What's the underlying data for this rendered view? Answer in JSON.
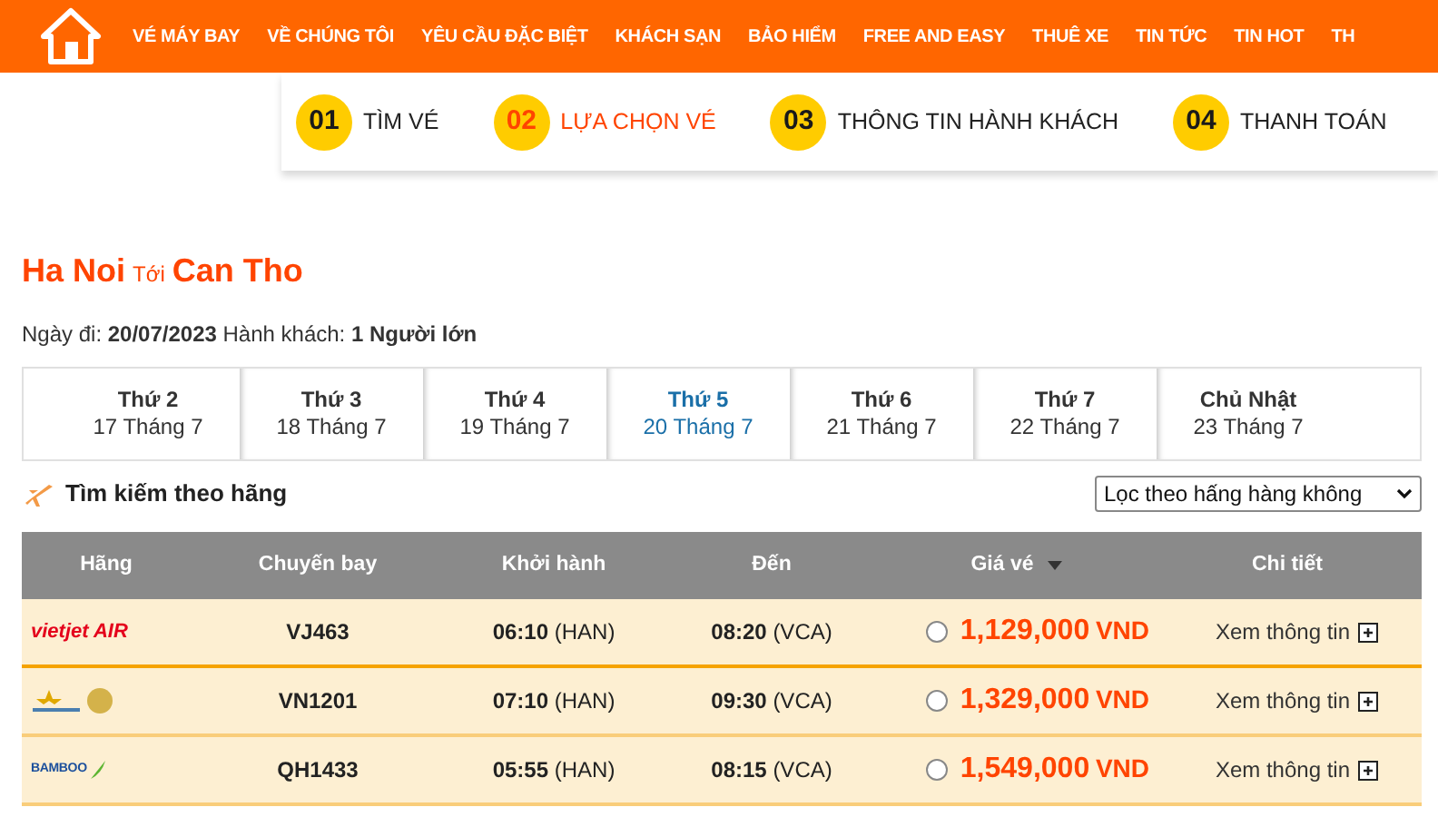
{
  "nav": {
    "items": [
      "VÉ MÁY BAY",
      "VỀ CHÚNG TÔI",
      "YÊU CẦU ĐẶC BIỆT",
      "KHÁCH SẠN",
      "BẢO HIỂM",
      "FREE AND EASY",
      "THUÊ XE",
      "TIN TỨC",
      "TIN HOT",
      "TH"
    ]
  },
  "steps": [
    {
      "number": "01",
      "label": "TÌM VÉ",
      "selected": false
    },
    {
      "number": "02",
      "label": "LỰA CHỌN VÉ",
      "selected": true
    },
    {
      "number": "03",
      "label": "THÔNG TIN HÀNH KHÁCH",
      "selected": false
    },
    {
      "number": "04",
      "label": "THANH TOÁN",
      "selected": false
    }
  ],
  "route": {
    "from": "Ha Noi",
    "connector": "Tới",
    "to": "Can Tho"
  },
  "summary": "Ngày đi: **20/07/2023** Hành khách: **1 Người lớn**",
  "days": [
    {
      "weekday": "Thứ 2",
      "date": "17 Tháng 7",
      "selected": false
    },
    {
      "weekday": "Thứ 3",
      "date": "18 Tháng 7",
      "selected": false
    },
    {
      "weekday": "Thứ 4",
      "date": "19 Tháng 7",
      "selected": false
    },
    {
      "weekday": "Thứ 5",
      "date": "20 Tháng 7",
      "selected": true
    },
    {
      "weekday": "Thứ 6",
      "date": "21 Tháng 7",
      "selected": false
    },
    {
      "weekday": "Thứ 7",
      "date": "22 Tháng 7",
      "selected": false
    },
    {
      "weekday": "Chủ Nhật",
      "date": "23 Tháng 7",
      "selected": false
    }
  ],
  "airline_search": {
    "title": "Tìm kiếm theo hãng",
    "filter": "Lọc theo hấng hàng không"
  },
  "table": {
    "columns": [
      "Hãng",
      "Chuyến bay",
      "Khởi hành",
      "Đến",
      "Giá vé",
      "Chi tiết"
    ],
    "rows": [
      {
        "logo": {
          "kind": "vietjet",
          "text": "vietjet AIR"
        },
        "flight": "VJ463",
        "depart": "06:10",
        "depart_code": "(HAN)",
        "arrive": "08:20",
        "arrive_code": "(VCA)",
        "selected": false,
        "price": "1,129,000",
        "currency": "VND",
        "details": "Xem thông tin"
      },
      {
        "logo": {
          "kind": "vietnam"
        },
        "flight": "VN1201",
        "depart": "07:10",
        "depart_code": "(HAN)",
        "arrive": "09:30",
        "arrive_code": "(VCA)",
        "selected": false,
        "price": "1,329,000",
        "currency": "VND",
        "details": "Xem thông tin"
      },
      {
        "logo": {
          "kind": "bamboo",
          "text": "BAMBOO"
        },
        "flight": "QH1433",
        "depart": "05:55",
        "depart_code": "(HAN)",
        "arrive": "08:15",
        "arrive_code": "(VCA)",
        "selected": false,
        "price": "1,549,000",
        "currency": "VND",
        "details": "Xem thông tin"
      }
    ]
  }
}
